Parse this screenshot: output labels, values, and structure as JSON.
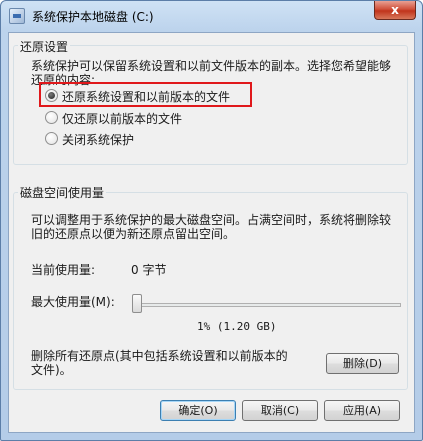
{
  "window": {
    "title": "系统保护本地磁盘 (C:)",
    "close_label": "x"
  },
  "restore_settings": {
    "group_title": "还原设置",
    "description_line1": "系统保护可以保留系统设置和以前文件版本的副本。选择您希望能够",
    "description_line2": "还原的内容:",
    "options": [
      {
        "label": "还原系统设置和以前版本的文件",
        "checked": true
      },
      {
        "label": "仅还原以前版本的文件",
        "checked": false
      },
      {
        "label": "关闭系统保护",
        "checked": false
      }
    ]
  },
  "disk_space": {
    "group_title": "磁盘空间使用量",
    "description_line1": "可以调整用于系统保护的最大磁盘空间。占满空间时，系统将删除较",
    "description_line2": "旧的还原点以便为新还原点留出空间。",
    "current_usage_label": "当前使用量:",
    "current_usage_value": "0 字节",
    "max_usage_label": "最大使用量(M):",
    "max_usage_percent": 1,
    "max_usage_text": "1% (1.20 GB)",
    "delete_description_line1": "删除所有还原点(其中包括系统设置和以前版本的",
    "delete_description_line2": "文件)。",
    "delete_button": "删除(D)"
  },
  "footer": {
    "ok_button": "确定(O)",
    "cancel_button": "取消(C)",
    "apply_button": "应用(A)"
  }
}
